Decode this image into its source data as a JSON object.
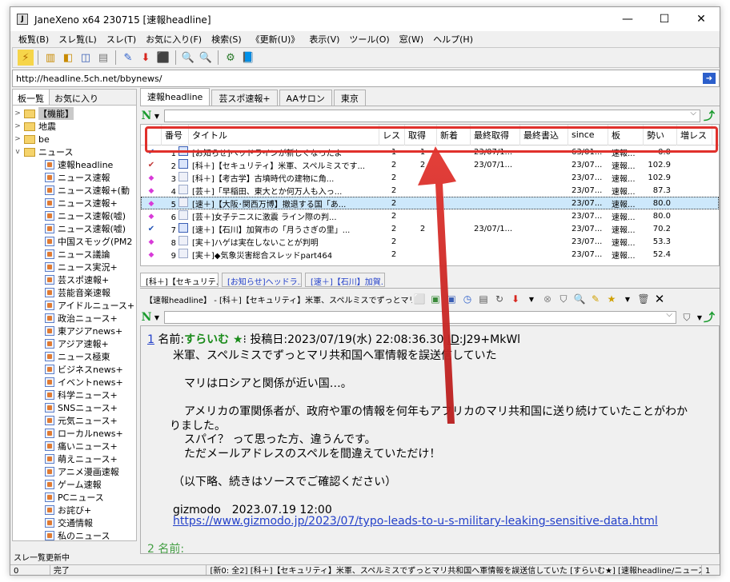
{
  "window": {
    "title": "JaneXeno x64 230715 [速報headline]",
    "minimize": "—",
    "maximize": "☐",
    "close": "✕"
  },
  "menu": [
    "板覧(B)",
    "スレ覧(L)",
    "スレ(T)",
    "お気に入り(F)",
    "検索(S)",
    "《更新(U)》",
    "表示(V)",
    "ツール(O)",
    "窓(W)",
    "ヘルプ(H)"
  ],
  "url": "http://headline.5ch.net/bbynews/",
  "left_tabs": [
    "板一覧",
    "お気に入り"
  ],
  "tree": {
    "folders": [
      {
        "label": "【機能】",
        "open": false,
        "selected": true
      },
      {
        "label": "地震",
        "open": false
      },
      {
        "label": "be",
        "open": false
      },
      {
        "label": "ニュース",
        "open": true
      }
    ],
    "boards": [
      "速報headline",
      "ニュース速報",
      "ニュース速報+(動",
      "ニュース速報+",
      "ニュース速報(嘘)",
      "ニュース速報(嘘)",
      "中国スモッグ(PM2",
      "ニュース議論",
      "ニュース実況+",
      "芸スポ速報+",
      "芸能音楽速報",
      "アイドルニュース+",
      "政治ニュース+",
      "東アジアnews+",
      "アジア速報+",
      "ニュース極東",
      "ビジネスnews+",
      "イベントnews+",
      "科学ニュース+",
      "SNSニュース+",
      "元気ニュース+",
      "ローカルnews+",
      "痛いニュース+",
      "萌えニュース+",
      "アニメ漫画速報",
      "ゲーム速報",
      "PCニュース",
      "お詫び+",
      "交通情報",
      "私のニュース"
    ]
  },
  "board_tabs": [
    "速報headline",
    "芸スポ速報+",
    "AAサロン",
    "東京"
  ],
  "filter_icon": "N",
  "columns": [
    "!",
    "番号",
    "タイトル",
    "レス",
    "取得",
    "新着",
    "最終取得",
    "最終書込",
    "since",
    "板",
    "勢い",
    "増レス"
  ],
  "threads": [
    {
      "mark": "✔",
      "mark_type": "check",
      "num": "1",
      "title": "[お知らせ]ヘッドラインが新しくなったよ",
      "res": "1",
      "got": "1",
      "new": "",
      "last_get": "23/07/1...",
      "last_post": "",
      "since": "63/01...",
      "board": "速報...",
      "speed": "0.0"
    },
    {
      "mark": "✔",
      "mark_type": "check-red",
      "num": "2",
      "title": "[科＋]【セキュリティ】米軍、スペルミスです...",
      "res": "2",
      "got": "2",
      "new": "",
      "last_get": "23/07/1...",
      "last_post": "",
      "since": "23/07...",
      "board": "速報...",
      "speed": "102.9"
    },
    {
      "mark": "◆",
      "mark_type": "dia",
      "num": "3",
      "title": "[科＋]【考古学】古墳時代の建物に角...",
      "res": "2",
      "got": "",
      "new": "",
      "last_get": "",
      "last_post": "",
      "since": "23/07...",
      "board": "速報...",
      "speed": "102.9"
    },
    {
      "mark": "◆",
      "mark_type": "dia",
      "num": "4",
      "title": "[芸＋]「早稲田、東大とか何万人も入っ...",
      "res": "2",
      "got": "",
      "new": "",
      "last_get": "",
      "last_post": "",
      "since": "23/07...",
      "board": "速報...",
      "speed": "87.3"
    },
    {
      "mark": "◆",
      "mark_type": "dia",
      "num": "5",
      "title": "[速＋]【大阪･関西万博】撤退する国「あ...",
      "res": "2",
      "got": "",
      "new": "",
      "last_get": "",
      "last_post": "",
      "since": "23/07...",
      "board": "速報...",
      "speed": "80.0",
      "highlight": true
    },
    {
      "mark": "◆",
      "mark_type": "dia",
      "num": "6",
      "title": "[芸＋]女子テニスに激震 ライン際の判...",
      "res": "2",
      "got": "",
      "new": "",
      "last_get": "",
      "last_post": "",
      "since": "23/07...",
      "board": "速報...",
      "speed": "80.0"
    },
    {
      "mark": "✔",
      "mark_type": "check",
      "num": "7",
      "title": "[速＋]【石川】加賀市の「月うさぎの里」...",
      "res": "2",
      "got": "2",
      "new": "",
      "last_get": "23/07/1...",
      "last_post": "",
      "since": "23/07...",
      "board": "速報...",
      "speed": "70.2"
    },
    {
      "mark": "◆",
      "mark_type": "dia",
      "num": "8",
      "title": "[実＋]ハゲは実在しないことが判明",
      "res": "2",
      "got": "",
      "new": "",
      "last_get": "",
      "last_post": "",
      "since": "23/07...",
      "board": "速報...",
      "speed": "53.3"
    },
    {
      "mark": "◆",
      "mark_type": "dia",
      "num": "9",
      "title": "[実＋]◆気象災害総合スレッドpart464",
      "res": "2",
      "got": "",
      "new": "",
      "last_get": "",
      "last_post": "",
      "since": "23/07...",
      "board": "速報...",
      "speed": "52.4"
    }
  ],
  "thread_tabs": [
    "[科＋]【セキュリテ...",
    "[お知らせ]ヘッドラ...",
    "[速＋]【石川】加賀..."
  ],
  "thread_info": "【速報headline】 - [科＋]【セキュリティ】米軍、スペルミスでずっとマリ共和",
  "post": {
    "number": "1",
    "name_label": "名前:",
    "name": "すらいむ ★",
    "name_tail": "⁝",
    "date": "投稿日:2023/07/19(水) 22:08:36.30",
    "id_label": "ID",
    "id": ":J29+MkWl",
    "lines": [
      "米軍、スペルミスでずっとマリ共和国へ軍情報を誤送信していた",
      "",
      "　マリはロシアと関係が近い国…。",
      "",
      "　アメリカの軍関係者が、政府や軍の情報を何年もアフリカのマリ共和国に送り続けていたことがわか",
      "りました。",
      "　スパイ？ って思った方、違うんです。",
      "　ただメールアドレスのスペルを間違えていただけ！",
      "",
      "（以下略、続きはソースでご確認ください）",
      "",
      "gizmodo　2023.07.19 12:00"
    ],
    "link": "https://www.gizmodo.jp/2023/07/typo-leads-to-u-s-military-leaking-sensitive-data.html",
    "next_partial": "2 名前:"
  },
  "status": {
    "top": "スレ一覧更新中",
    "count": "0",
    "state": "完了",
    "info": "[新0: 全2] [科＋]【セキュリティ】米軍、スペルミスでずっとマリ共和国へ軍情報を誤送信していた [すらいむ★] [速報headline/ニュース]",
    "right": "1"
  },
  "colors": {
    "highlight_red": "#e0302b",
    "link_blue": "#2340c9",
    "name_green": "#1a8b1a",
    "selected_row": "#cde8fb"
  }
}
